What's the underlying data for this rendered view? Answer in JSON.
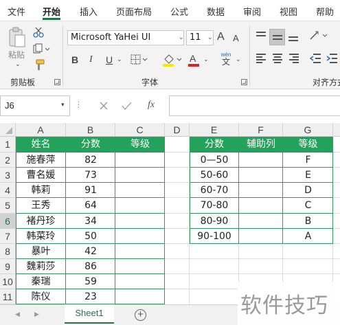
{
  "menu": {
    "items": [
      "文件",
      "开始",
      "插入",
      "页面布局",
      "公式",
      "数据",
      "审阅",
      "视图",
      "帮助"
    ],
    "active": "开始"
  },
  "ribbon": {
    "clipboard": {
      "paste_label": "粘贴",
      "group_label": "剪贴板"
    },
    "font": {
      "font_name": "Microsoft YaHei UI",
      "font_size": "11",
      "bold_label": "B",
      "italic_label": "I",
      "underline_label": "U",
      "grow_label": "A",
      "shrink_label": "A",
      "phonetic_top": "wén",
      "phonetic_bottom": "文",
      "font_color_label": "A",
      "group_label": "字体"
    },
    "alignment": {
      "group_label": "对齐方式"
    }
  },
  "formula_bar": {
    "name_box": "J6",
    "fx_label": "fx",
    "formula": ""
  },
  "columns": [
    "A",
    "B",
    "C",
    "D",
    "E",
    "F",
    "G"
  ],
  "rows": [
    "1",
    "2",
    "3",
    "4",
    "5",
    "6",
    "7",
    "8",
    "9",
    "10",
    "11"
  ],
  "selected_row": "6",
  "table1": {
    "headers": [
      "姓名",
      "分数",
      "等级"
    ],
    "rows": [
      [
        "施春萍",
        "82",
        ""
      ],
      [
        "曹名媛",
        "73",
        ""
      ],
      [
        "韩莉",
        "91",
        ""
      ],
      [
        "王秀",
        "64",
        ""
      ],
      [
        "褚丹珍",
        "34",
        ""
      ],
      [
        "韩菜玲",
        "50",
        ""
      ],
      [
        "暴叶",
        "42",
        ""
      ],
      [
        "魏莉莎",
        "86",
        ""
      ],
      [
        "秦瑞",
        "59",
        ""
      ],
      [
        "陈仪",
        "23",
        ""
      ]
    ]
  },
  "table2": {
    "headers": [
      "分数",
      "辅助列",
      "等级"
    ],
    "rows": [
      [
        "0—50",
        "",
        "F"
      ],
      [
        "50-60",
        "",
        "E"
      ],
      [
        "60-70",
        "",
        "D"
      ],
      [
        "70-80",
        "",
        "C"
      ],
      [
        "80-90",
        "",
        "B"
      ],
      [
        "90-100",
        "",
        "A"
      ]
    ]
  },
  "sheet_tabs": {
    "active": "Sheet1",
    "add": "+"
  },
  "watermark": "软件技巧",
  "colors": {
    "accent": "#217346",
    "header_fill": "#22a25a",
    "table_border": "#2e9b5b"
  }
}
